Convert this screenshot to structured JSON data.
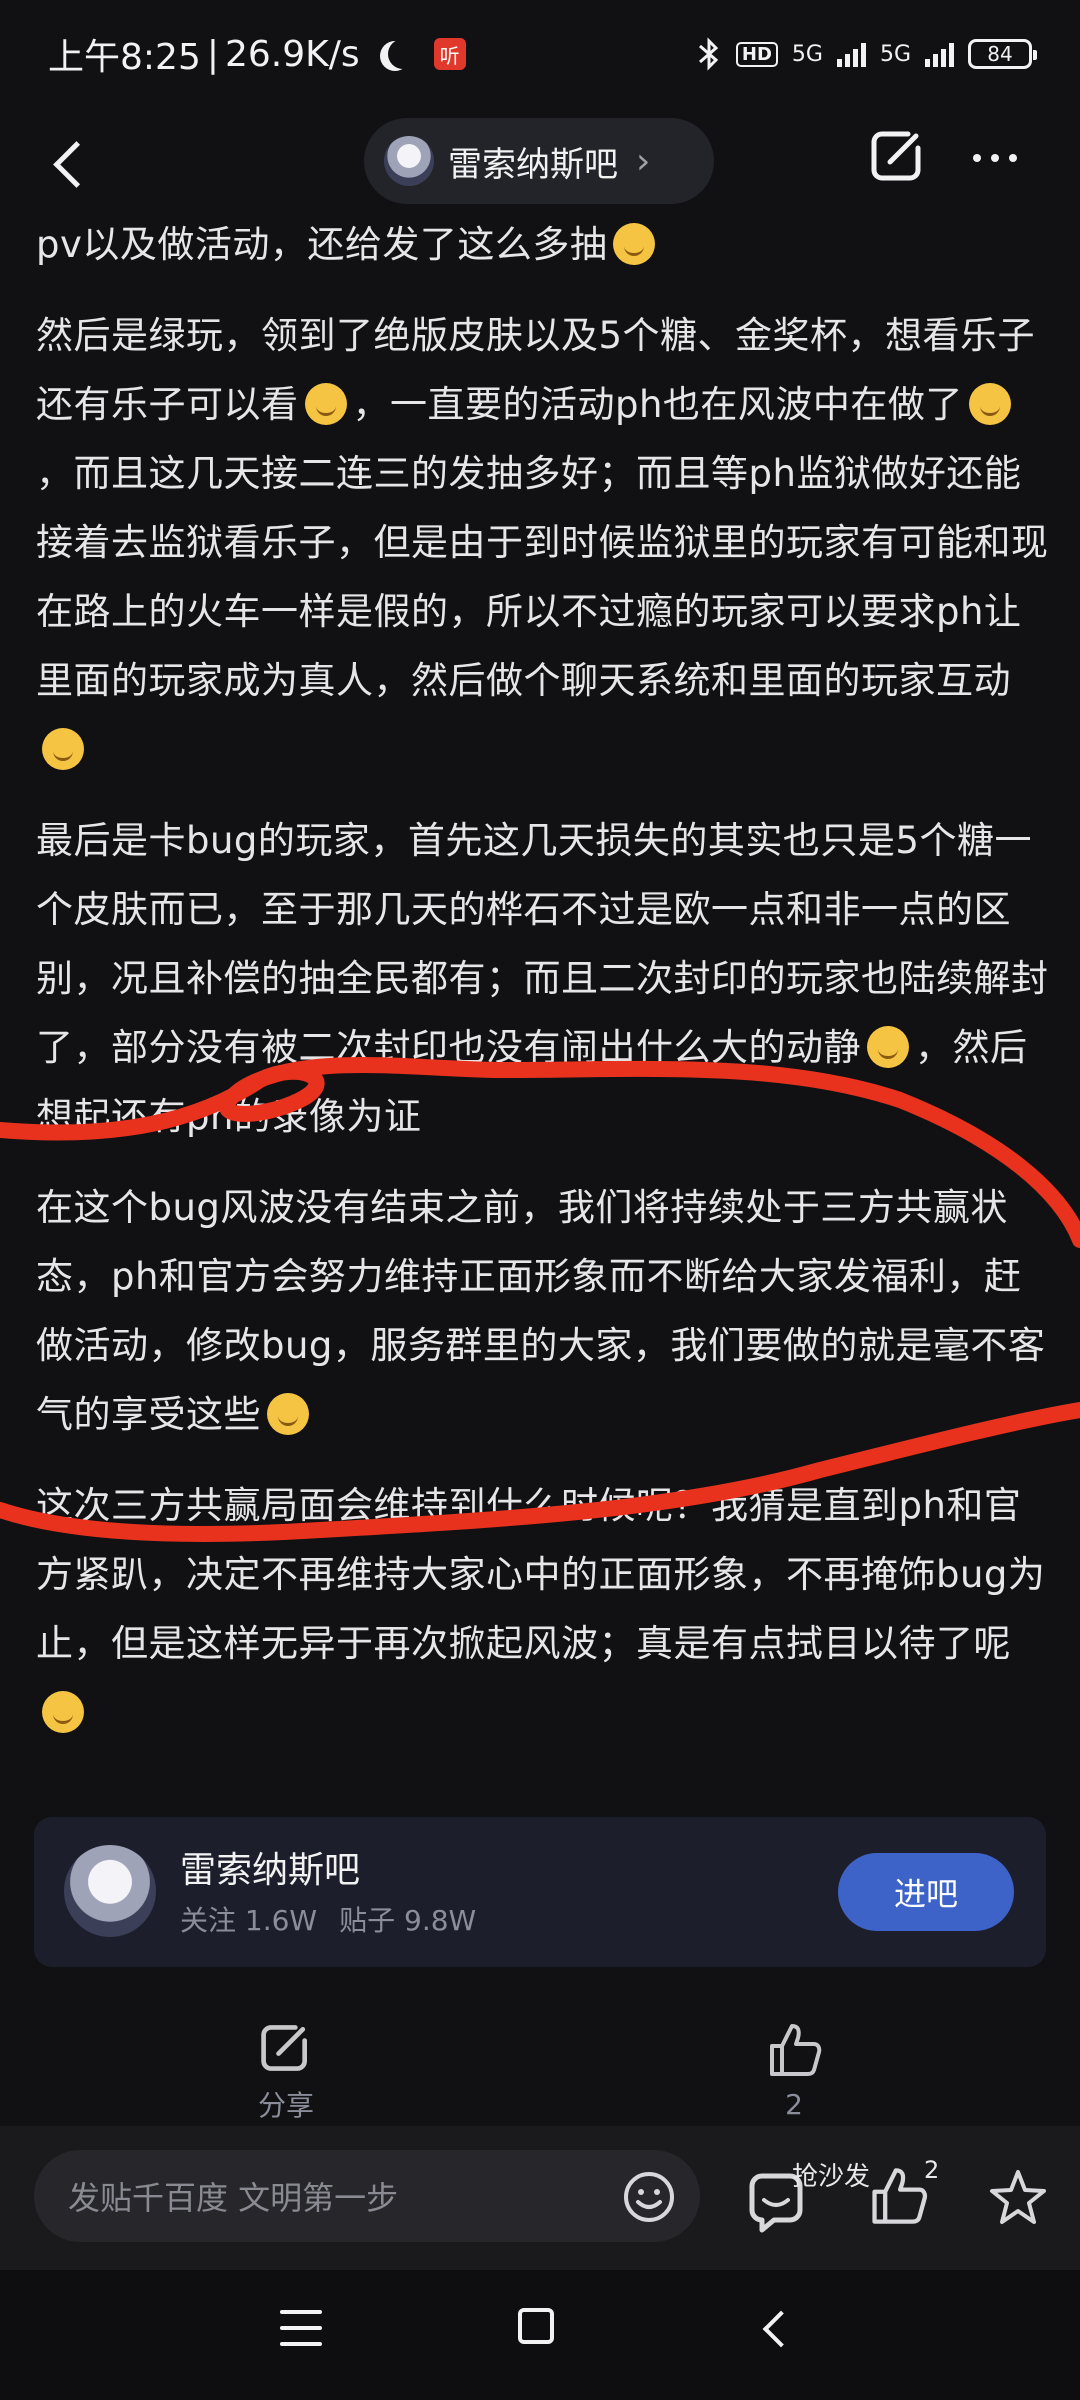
{
  "status_bar": {
    "time": "上午8:25",
    "speed": "26.9K/s",
    "listen_badge": "听",
    "hd_label": "HD",
    "network_1": "5G",
    "network_2": "5G",
    "battery": "84"
  },
  "nav": {
    "forum_name": "雷索纳斯吧"
  },
  "article": {
    "paragraphs": [
      "pv以及做活动，还给发了这么多抽",
      "然后是绿玩，领到了绝版皮肤以及5个糖、金奖杯，想看乐子还有乐子可以看",
      "，一直要的活动ph也在风波中在做了",
      "，而且这几天接二连三的发抽多好；而且等ph监狱做好还能接着去监狱看乐子，但是由于到时候监狱里的玩家有可能和现在路上的火车一样是假的，所以不过瘾的玩家可以要求ph让里面的玩家成为真人，然后做个聊天系统和里面的玩家互动",
      "最后是卡bug的玩家，首先这几天损失的其实也只是5个糖一个皮肤而已，至于那几天的桦石不过是欧一点和非一点的区别，况且补偿的抽全民都有；而且二次封印的玩家也陆续解封了，部分没有被二次封印也没有闹出什么大的动静",
      "，然后想起还有ph的录像为证",
      "在这个bug风波没有结束之前，我们将持续处于三方共赢状态，ph和官方会努力维持正面形象而不断给大家发福利，赶做活动，修改bug，服务群里的大家，我们要做的就是毫不客气的享受这些",
      "这次三方共赢局面会维持到什么时候呢？我猜是直到ph和官方紧趴，决定不再维持大家心中的正面形象，不再掩饰bug为止，但是这样无异于再次掀起风波；真是有点拭目以待了呢"
    ]
  },
  "forum_card": {
    "name": "雷索纳斯吧",
    "followers": "关注 1.6W",
    "posts": "贴子 9.8W",
    "enter_label": "进吧"
  },
  "actions": {
    "share_label": "分享",
    "like_count": "2"
  },
  "bottom_bar": {
    "input_placeholder": "发贴千百度 文明第一步",
    "sofa_label": "抢沙发",
    "like_count": "2"
  },
  "colors": {
    "background": "#111113",
    "accent_blue": "#3d62c8",
    "scribble_red": "#e8321e",
    "listen_badge": "#e0392b"
  },
  "icons": [
    "back-icon",
    "edit-icon",
    "more-icon",
    "share-icon",
    "thumbs-up-icon",
    "emoji-icon",
    "sofa-icon",
    "star-icon",
    "menu-icon",
    "home-icon"
  ]
}
